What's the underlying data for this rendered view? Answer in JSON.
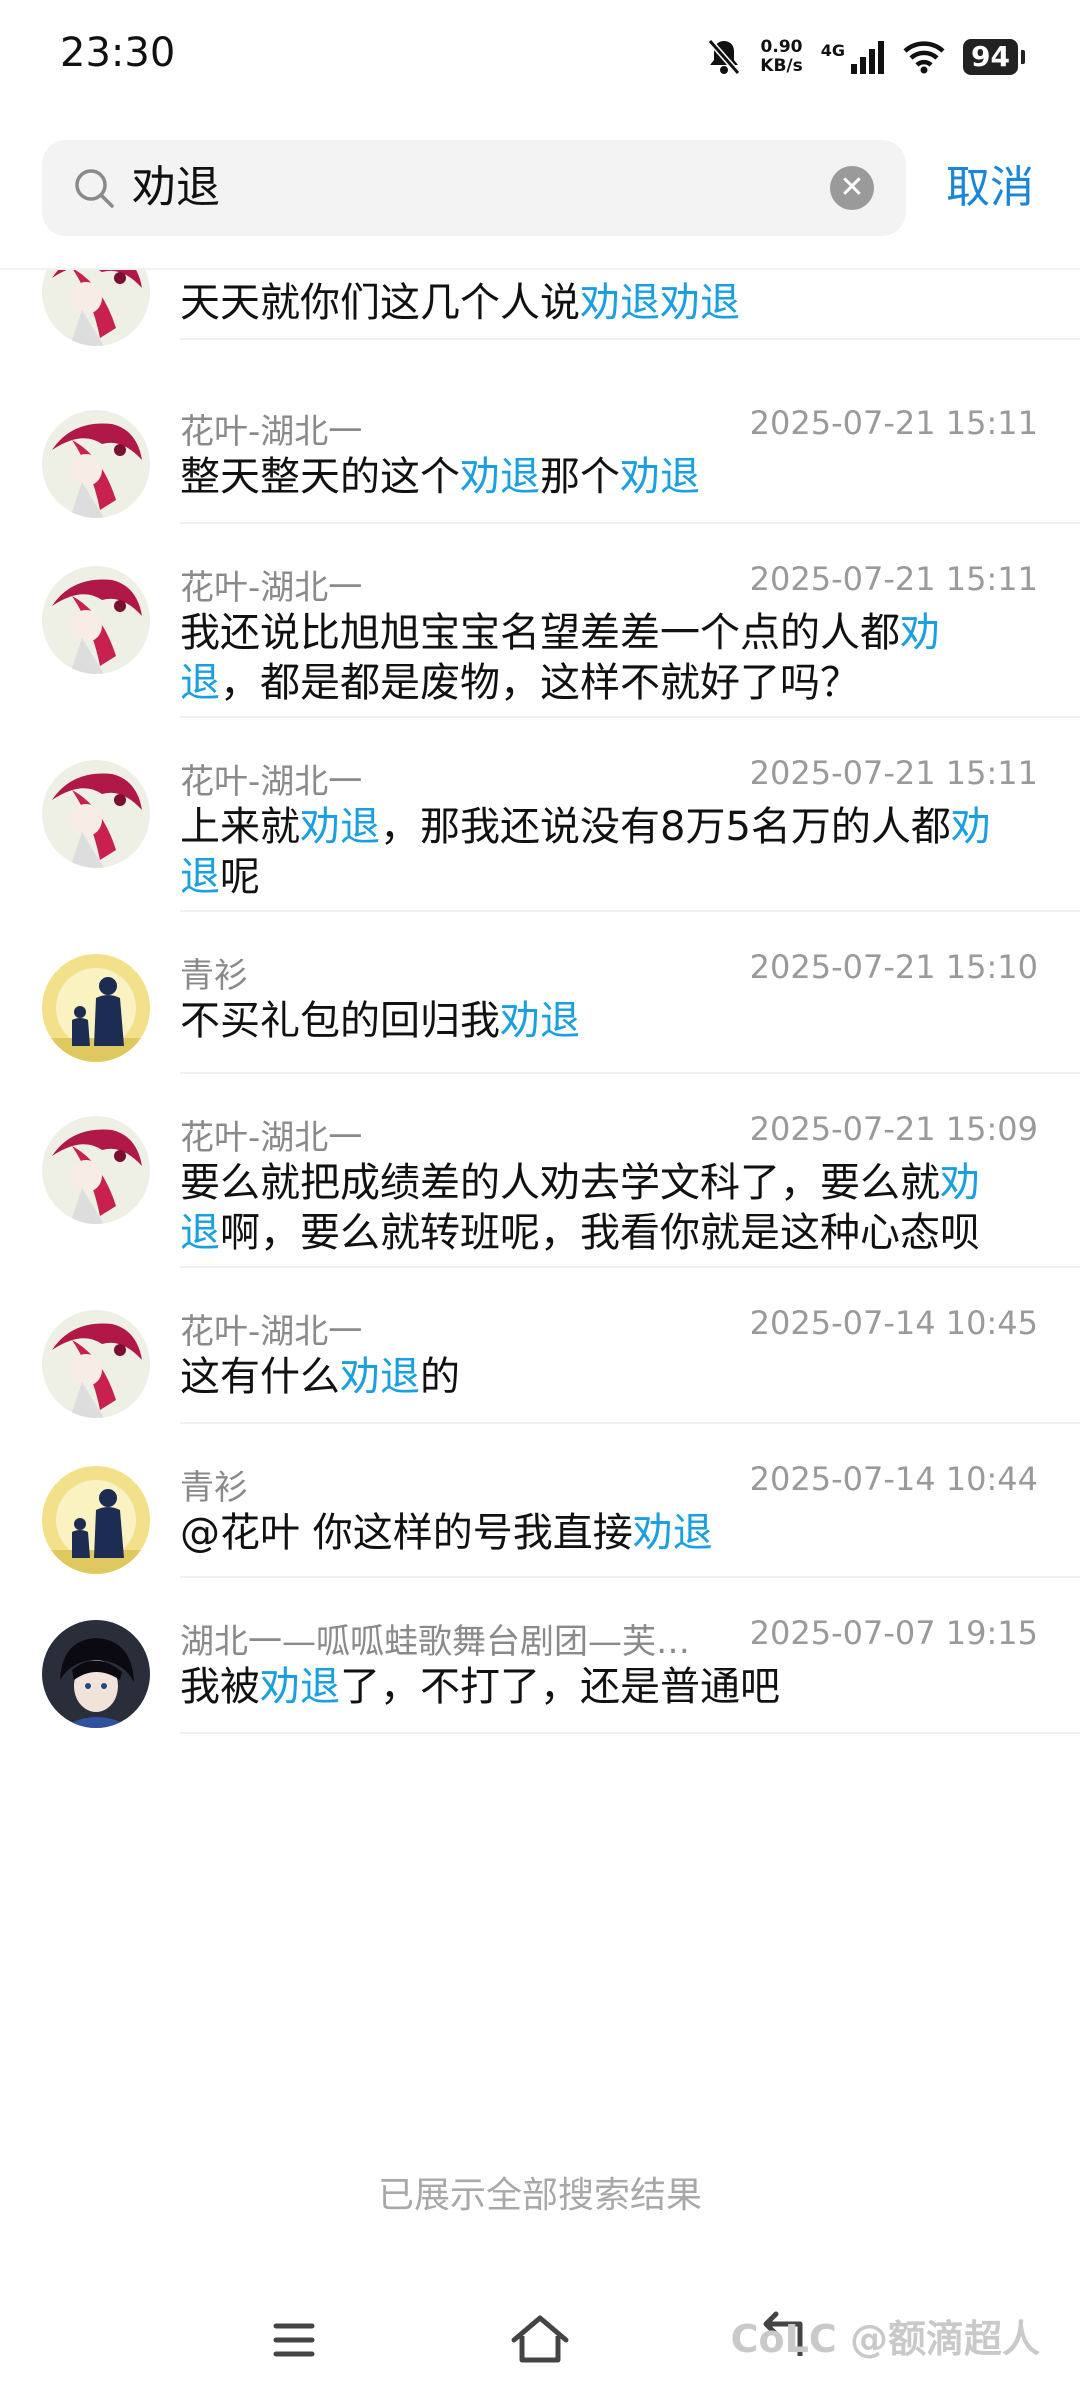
{
  "status": {
    "time": "23:30",
    "speed_value": "0.90",
    "speed_unit": "KB/s",
    "network": "4G",
    "battery": "94"
  },
  "search": {
    "query": "劝退",
    "cancel_label": "取消"
  },
  "results": [
    {
      "avatar": "anime",
      "user": "",
      "time": "",
      "message": [
        [
          "天天就你们这几个人说",
          0
        ],
        [
          "劝退劝退",
          1
        ]
      ]
    },
    {
      "avatar": "anime",
      "user": "花叶-湖北一",
      "time": "2025-07-21 15:11",
      "message": [
        [
          "整天整天的这个",
          0
        ],
        [
          "劝退",
          1
        ],
        [
          "那个",
          0
        ],
        [
          "劝退",
          1
        ]
      ]
    },
    {
      "avatar": "anime",
      "user": "花叶-湖北一",
      "time": "2025-07-21 15:11",
      "message": [
        [
          "我还说比旭旭宝宝名望差差一个点的人都",
          0
        ],
        [
          "劝退",
          1
        ],
        [
          "，都是都是废物，这样不就好了吗？",
          0
        ]
      ]
    },
    {
      "avatar": "anime",
      "user": "花叶-湖北一",
      "time": "2025-07-21 15:11",
      "message": [
        [
          "上来就",
          0
        ],
        [
          "劝退",
          1
        ],
        [
          "，那我还说没有8万5名万的人都",
          0
        ],
        [
          "劝退",
          1
        ],
        [
          "呢",
          0
        ]
      ]
    },
    {
      "avatar": "silhouette",
      "user": "青衫",
      "time": "2025-07-21 15:10",
      "message": [
        [
          "不买礼包的回归我",
          0
        ],
        [
          "劝退",
          1
        ]
      ]
    },
    {
      "avatar": "anime",
      "user": "花叶-湖北一",
      "time": "2025-07-21 15:09",
      "message": [
        [
          "要么就把成绩差的人劝去学文科了，要么就",
          0
        ],
        [
          "劝退",
          1
        ],
        [
          "啊，要么就转班呢，我看你就是这种心态呗",
          0
        ]
      ]
    },
    {
      "avatar": "anime",
      "user": "花叶-湖北一",
      "time": "2025-07-14 10:45",
      "message": [
        [
          "这有什么",
          0
        ],
        [
          "劝退",
          1
        ],
        [
          "的",
          0
        ]
      ]
    },
    {
      "avatar": "silhouette",
      "user": "青衫",
      "time": "2025-07-14 10:44",
      "message": [
        [
          "@花叶  你这样的号我直接",
          0
        ],
        [
          "劝退",
          1
        ]
      ]
    },
    {
      "avatar": "dark",
      "user": "湖北一—呱呱蛙歌舞台剧团—芙…",
      "time": "2025-07-07 19:15",
      "message": [
        [
          "我被",
          0
        ],
        [
          "劝退",
          1
        ],
        [
          "了，不打了，还是普通吧",
          0
        ]
      ]
    }
  ],
  "end_text": "已展示全部搜索结果",
  "watermark": "CoLC @额滴超人",
  "icons": {
    "menu": "menu-icon",
    "home": "home-icon",
    "back": "back-icon",
    "search": "search-icon",
    "clear": "clear-icon"
  },
  "colors": {
    "highlight": "#1aa0e0",
    "cancel": "#1a86d9"
  }
}
